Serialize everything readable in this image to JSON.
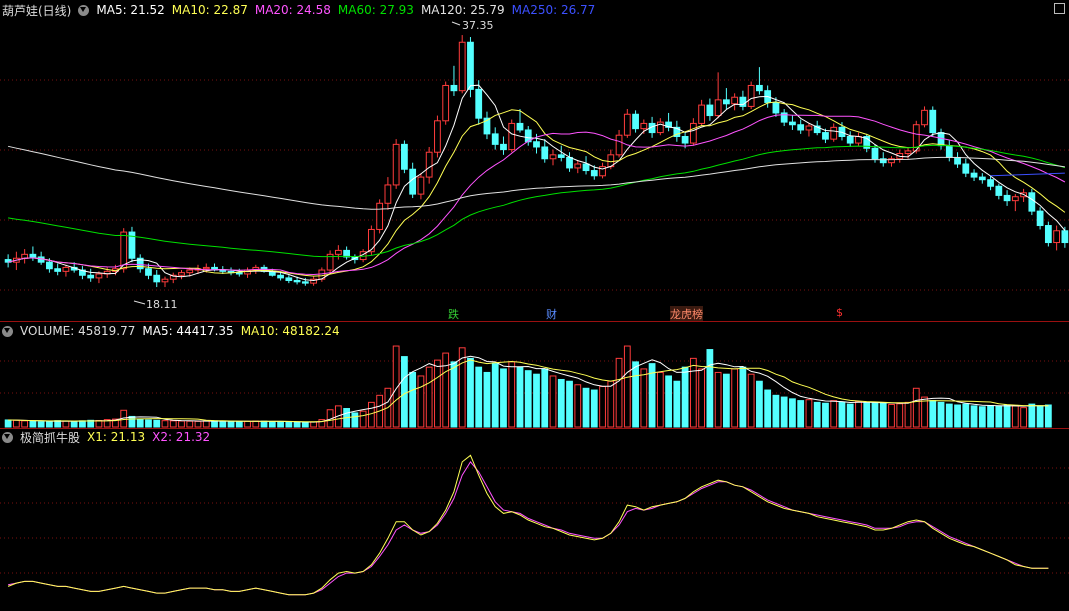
{
  "price_header": {
    "title": "葫芦娃(日线)",
    "ma5": "MA5: 21.52",
    "ma10": "MA10: 22.87",
    "ma20": "MA20: 24.58",
    "ma60": "MA60: 27.93",
    "ma120": "MA120: 25.79",
    "ma250": "MA250: 26.77"
  },
  "volume_header": {
    "volume": "VOLUME: 45819.77",
    "ma5": "MA5: 44417.35",
    "ma10": "MA10: 48182.24"
  },
  "indicator_header": {
    "name": "极简抓牛股",
    "x1": "X1: 21.13",
    "x2": "X2: 21.32"
  },
  "colors": {
    "up": "#ff3c3c",
    "down": "#54ffff",
    "ma5": "#ffffff",
    "ma10": "#ffff54",
    "ma20": "#ff54ff",
    "ma60": "#00e000",
    "ma120": "#e0e0e0",
    "ma250": "#3c50ff",
    "grid": "#7a1010"
  },
  "chart_data": [
    {
      "type": "candlestick",
      "name": "price",
      "annotations": {
        "high": "37.35",
        "low": "18.11"
      },
      "markers": [
        {
          "text": "跌",
          "color": "#33cc33"
        },
        {
          "text": "财",
          "color": "#5a8cff"
        },
        {
          "text": "龙虎榜",
          "color": "#ff8a6a"
        },
        {
          "text": "$",
          "color": "#ff3030"
        }
      ],
      "ohlc": [
        [
          20.2,
          20.6,
          19.6,
          20.0
        ],
        [
          20.0,
          20.8,
          19.4,
          20.3
        ],
        [
          20.3,
          21.0,
          19.9,
          20.6
        ],
        [
          20.6,
          21.2,
          20.1,
          20.4
        ],
        [
          20.4,
          20.8,
          19.8,
          20.0
        ],
        [
          20.0,
          20.3,
          19.2,
          19.5
        ],
        [
          19.5,
          19.9,
          19.0,
          19.3
        ],
        [
          19.3,
          19.8,
          18.9,
          19.6
        ],
        [
          19.6,
          20.0,
          19.2,
          19.4
        ],
        [
          19.4,
          19.7,
          18.7,
          19.0
        ],
        [
          19.0,
          19.5,
          18.5,
          18.8
        ],
        [
          18.8,
          19.3,
          18.4,
          19.1
        ],
        [
          19.1,
          19.6,
          18.8,
          19.3
        ],
        [
          19.3,
          19.8,
          19.0,
          19.5
        ],
        [
          19.5,
          22.6,
          19.2,
          22.3
        ],
        [
          22.3,
          22.7,
          20.0,
          20.3
        ],
        [
          20.3,
          20.6,
          19.2,
          19.5
        ],
        [
          19.5,
          19.9,
          18.7,
          19.0
        ],
        [
          19.0,
          19.4,
          18.1,
          18.5
        ],
        [
          18.5,
          18.9,
          18.1,
          18.7
        ],
        [
          18.7,
          19.2,
          18.4,
          19.0
        ],
        [
          19.0,
          19.4,
          18.7,
          19.2
        ],
        [
          19.2,
          19.6,
          18.9,
          19.4
        ],
        [
          19.4,
          19.8,
          19.1,
          19.5
        ],
        [
          19.5,
          19.9,
          19.2,
          19.6
        ],
        [
          19.6,
          19.9,
          19.3,
          19.4
        ],
        [
          19.4,
          19.7,
          19.1,
          19.3
        ],
        [
          19.3,
          19.6,
          19.0,
          19.2
        ],
        [
          19.2,
          19.5,
          18.9,
          19.1
        ],
        [
          19.1,
          19.6,
          18.8,
          19.4
        ],
        [
          19.4,
          19.8,
          19.1,
          19.6
        ],
        [
          19.6,
          19.8,
          19.2,
          19.3
        ],
        [
          19.3,
          19.5,
          18.9,
          19.0
        ],
        [
          19.0,
          19.3,
          18.6,
          18.8
        ],
        [
          18.8,
          19.0,
          18.4,
          18.6
        ],
        [
          18.6,
          18.9,
          18.3,
          18.5
        ],
        [
          18.5,
          18.8,
          18.2,
          18.4
        ],
        [
          18.4,
          18.9,
          18.2,
          18.7
        ],
        [
          18.7,
          19.6,
          18.5,
          19.4
        ],
        [
          19.4,
          20.9,
          19.2,
          20.6
        ],
        [
          20.6,
          21.3,
          20.2,
          20.9
        ],
        [
          20.9,
          21.2,
          20.2,
          20.4
        ],
        [
          20.4,
          20.6,
          19.9,
          20.2
        ],
        [
          20.2,
          21.0,
          20.0,
          20.8
        ],
        [
          20.8,
          22.8,
          20.5,
          22.5
        ],
        [
          22.5,
          24.8,
          22.2,
          24.5
        ],
        [
          24.5,
          26.5,
          24.0,
          25.9
        ],
        [
          25.9,
          29.4,
          25.6,
          29.0
        ],
        [
          29.0,
          29.3,
          26.8,
          27.1
        ],
        [
          27.1,
          27.6,
          24.9,
          25.2
        ],
        [
          25.2,
          26.8,
          24.8,
          26.5
        ],
        [
          26.5,
          28.8,
          26.0,
          28.4
        ],
        [
          28.4,
          31.2,
          28.0,
          30.8
        ],
        [
          30.8,
          33.8,
          30.5,
          33.5
        ],
        [
          33.5,
          35.0,
          32.7,
          33.1
        ],
        [
          33.1,
          37.35,
          32.9,
          36.8
        ],
        [
          36.8,
          37.2,
          32.6,
          33.2
        ],
        [
          33.2,
          33.9,
          30.5,
          31.0
        ],
        [
          31.0,
          31.5,
          29.4,
          29.8
        ],
        [
          29.8,
          30.3,
          28.6,
          29.0
        ],
        [
          29.0,
          29.6,
          28.2,
          28.6
        ],
        [
          28.6,
          30.9,
          28.4,
          30.6
        ],
        [
          30.6,
          31.7,
          29.9,
          30.1
        ],
        [
          30.1,
          30.4,
          28.9,
          29.2
        ],
        [
          29.2,
          29.8,
          28.3,
          28.8
        ],
        [
          28.8,
          29.4,
          27.6,
          27.9
        ],
        [
          27.9,
          28.6,
          27.4,
          28.2
        ],
        [
          28.2,
          28.9,
          27.7,
          28.0
        ],
        [
          28.0,
          28.4,
          26.9,
          27.2
        ],
        [
          27.2,
          27.8,
          26.8,
          27.5
        ],
        [
          27.5,
          28.1,
          26.7,
          27.0
        ],
        [
          27.0,
          27.4,
          26.3,
          26.6
        ],
        [
          26.6,
          27.6,
          26.4,
          27.3
        ],
        [
          27.3,
          28.6,
          27.1,
          28.2
        ],
        [
          28.2,
          30.1,
          28.0,
          29.7
        ],
        [
          29.7,
          31.7,
          29.5,
          31.3
        ],
        [
          31.3,
          31.6,
          29.9,
          30.2
        ],
        [
          30.2,
          30.9,
          29.8,
          30.6
        ],
        [
          30.6,
          31.1,
          29.5,
          29.9
        ],
        [
          29.9,
          31.0,
          29.7,
          30.7
        ],
        [
          30.7,
          31.4,
          30.0,
          30.3
        ],
        [
          30.3,
          30.8,
          29.2,
          29.6
        ],
        [
          29.6,
          30.0,
          28.7,
          29.1
        ],
        [
          29.1,
          31.0,
          28.9,
          30.6
        ],
        [
          30.6,
          32.4,
          30.4,
          32.0
        ],
        [
          32.0,
          32.5,
          30.8,
          31.2
        ],
        [
          31.2,
          34.5,
          31.0,
          32.4
        ],
        [
          32.4,
          33.3,
          31.7,
          32.1
        ],
        [
          32.1,
          32.9,
          31.6,
          32.6
        ],
        [
          32.6,
          33.1,
          31.6,
          31.9
        ],
        [
          31.9,
          33.8,
          31.7,
          33.5
        ],
        [
          33.5,
          34.9,
          32.8,
          33.1
        ],
        [
          33.1,
          33.5,
          31.8,
          32.2
        ],
        [
          32.2,
          32.6,
          31.1,
          31.4
        ],
        [
          31.4,
          31.7,
          30.4,
          30.7
        ],
        [
          30.7,
          31.2,
          30.1,
          30.5
        ],
        [
          30.5,
          30.9,
          29.8,
          30.1
        ],
        [
          30.1,
          30.6,
          29.6,
          30.4
        ],
        [
          30.4,
          30.8,
          29.7,
          29.9
        ],
        [
          29.9,
          30.2,
          29.1,
          29.4
        ],
        [
          29.4,
          30.6,
          29.2,
          30.3
        ],
        [
          30.3,
          30.7,
          29.3,
          29.6
        ],
        [
          29.6,
          30.0,
          28.8,
          29.1
        ],
        [
          29.1,
          29.9,
          28.9,
          29.6
        ],
        [
          29.6,
          29.8,
          28.4,
          28.7
        ],
        [
          28.7,
          29.0,
          27.6,
          27.9
        ],
        [
          27.9,
          28.4,
          27.3,
          27.6
        ],
        [
          27.6,
          28.1,
          27.3,
          27.9
        ],
        [
          27.9,
          28.6,
          27.6,
          28.3
        ],
        [
          28.3,
          28.8,
          27.9,
          28.5
        ],
        [
          28.5,
          30.8,
          28.3,
          30.5
        ],
        [
          30.5,
          31.9,
          30.3,
          31.6
        ],
        [
          31.6,
          31.9,
          29.6,
          29.9
        ],
        [
          29.9,
          30.2,
          28.6,
          28.9
        ],
        [
          28.9,
          29.3,
          27.7,
          28.0
        ],
        [
          28.0,
          28.4,
          27.2,
          27.5
        ],
        [
          27.5,
          27.9,
          26.5,
          26.8
        ],
        [
          26.8,
          27.1,
          26.2,
          26.5
        ],
        [
          26.5,
          26.8,
          26.0,
          26.3
        ],
        [
          26.3,
          26.6,
          25.5,
          25.8
        ],
        [
          25.8,
          26.0,
          24.8,
          25.1
        ],
        [
          25.1,
          25.5,
          24.3,
          24.7
        ],
        [
          24.7,
          25.2,
          23.9,
          25.0
        ],
        [
          25.0,
          25.6,
          24.6,
          25.3
        ],
        [
          25.3,
          25.6,
          23.6,
          23.9
        ],
        [
          23.9,
          24.2,
          22.5,
          22.8
        ],
        [
          22.8,
          23.1,
          21.2,
          21.5
        ],
        [
          21.5,
          22.8,
          20.9,
          22.4
        ],
        [
          22.4,
          22.7,
          21.1,
          21.5
        ]
      ],
      "ma250_values": [
        26.6,
        26.8
      ]
    },
    {
      "type": "bar",
      "name": "volume",
      "values": [
        4000,
        3800,
        3500,
        3200,
        3000,
        3300,
        3600,
        3400,
        3100,
        3500,
        3800,
        3700,
        4200,
        4500,
        9500,
        6000,
        4500,
        4000,
        3800,
        3600,
        3500,
        3400,
        3300,
        3200,
        3400,
        3500,
        3300,
        3100,
        3000,
        3200,
        3400,
        3300,
        3100,
        2900,
        2800,
        2700,
        2600,
        2900,
        4200,
        9800,
        12000,
        10500,
        8000,
        9000,
        14000,
        18000,
        22000,
        46000,
        40000,
        31000,
        29000,
        34000,
        38000,
        42000,
        37000,
        45000,
        39000,
        34000,
        31000,
        36000,
        33000,
        37000,
        34000,
        32000,
        30000,
        33000,
        29000,
        27000,
        26000,
        24000,
        22000,
        21000,
        23000,
        26000,
        39000,
        46000,
        37000,
        33000,
        36000,
        31000,
        29000,
        26000,
        34000,
        39000,
        33000,
        44000,
        31000,
        30000,
        33000,
        34000,
        30000,
        26000,
        21000,
        18000,
        17000,
        16000,
        15000,
        15500,
        14000,
        13500,
        15000,
        14200,
        13000,
        14500,
        13800,
        14000,
        13500,
        12800,
        13200,
        14000,
        22000,
        17000,
        15000,
        14000,
        13000,
        12500,
        13000,
        12000,
        11500,
        12200,
        11800,
        12500,
        12000,
        11000,
        13000,
        12000,
        12500
      ]
    },
    {
      "type": "line",
      "name": "indicator",
      "series": [
        {
          "name": "X1",
          "values": [
            13,
            15,
            16,
            16,
            15,
            14,
            13,
            13,
            12,
            11,
            10,
            10,
            11,
            12,
            13,
            12,
            11,
            10,
            9,
            9,
            10,
            11,
            12,
            12,
            12,
            11,
            11,
            10,
            10,
            11,
            12,
            11,
            10,
            9,
            8,
            8,
            8,
            9,
            12,
            17,
            21,
            22,
            21,
            22,
            26,
            33,
            42,
            52,
            52,
            47,
            44,
            46,
            51,
            59,
            70,
            88,
            92,
            80,
            69,
            61,
            57,
            58,
            56,
            53,
            51,
            49,
            48,
            46,
            44,
            43,
            42,
            41,
            42,
            45,
            52,
            62,
            61,
            59,
            61,
            62,
            63,
            64,
            66,
            70,
            73,
            75,
            77,
            76,
            74,
            73,
            70,
            67,
            64,
            62,
            60,
            59,
            58,
            57,
            55,
            54,
            53,
            52,
            51,
            50,
            49,
            47,
            47,
            48,
            50,
            52,
            53,
            52,
            48,
            45,
            42,
            40,
            38,
            37,
            35,
            33,
            31,
            29,
            26,
            25,
            24,
            24,
            24
          ]
        },
        {
          "name": "X2",
          "values": [
            14,
            15,
            16,
            16,
            15,
            14,
            13,
            13,
            12,
            11,
            10,
            10,
            11,
            12,
            13,
            12,
            11,
            10,
            9,
            9,
            10,
            11,
            12,
            12,
            12,
            11,
            11,
            10,
            10,
            11,
            12,
            11,
            10,
            9,
            8,
            8,
            8,
            9,
            11,
            15,
            19,
            21,
            21,
            22,
            25,
            31,
            38,
            47,
            50,
            47,
            45,
            46,
            50,
            57,
            66,
            80,
            88,
            82,
            73,
            64,
            59,
            58,
            57,
            54,
            52,
            50,
            48,
            47,
            45,
            44,
            43,
            42,
            42,
            45,
            50,
            58,
            60,
            59,
            60,
            62,
            63,
            64,
            66,
            69,
            72,
            74,
            76,
            76,
            74,
            73,
            71,
            68,
            65,
            63,
            61,
            59,
            58,
            57,
            56,
            55,
            54,
            53,
            52,
            51,
            50,
            48,
            48,
            48,
            49,
            51,
            52,
            52,
            49,
            46,
            43,
            41,
            39,
            37,
            35,
            33,
            31,
            29,
            27,
            25,
            24,
            24,
            24
          ]
        }
      ]
    }
  ]
}
